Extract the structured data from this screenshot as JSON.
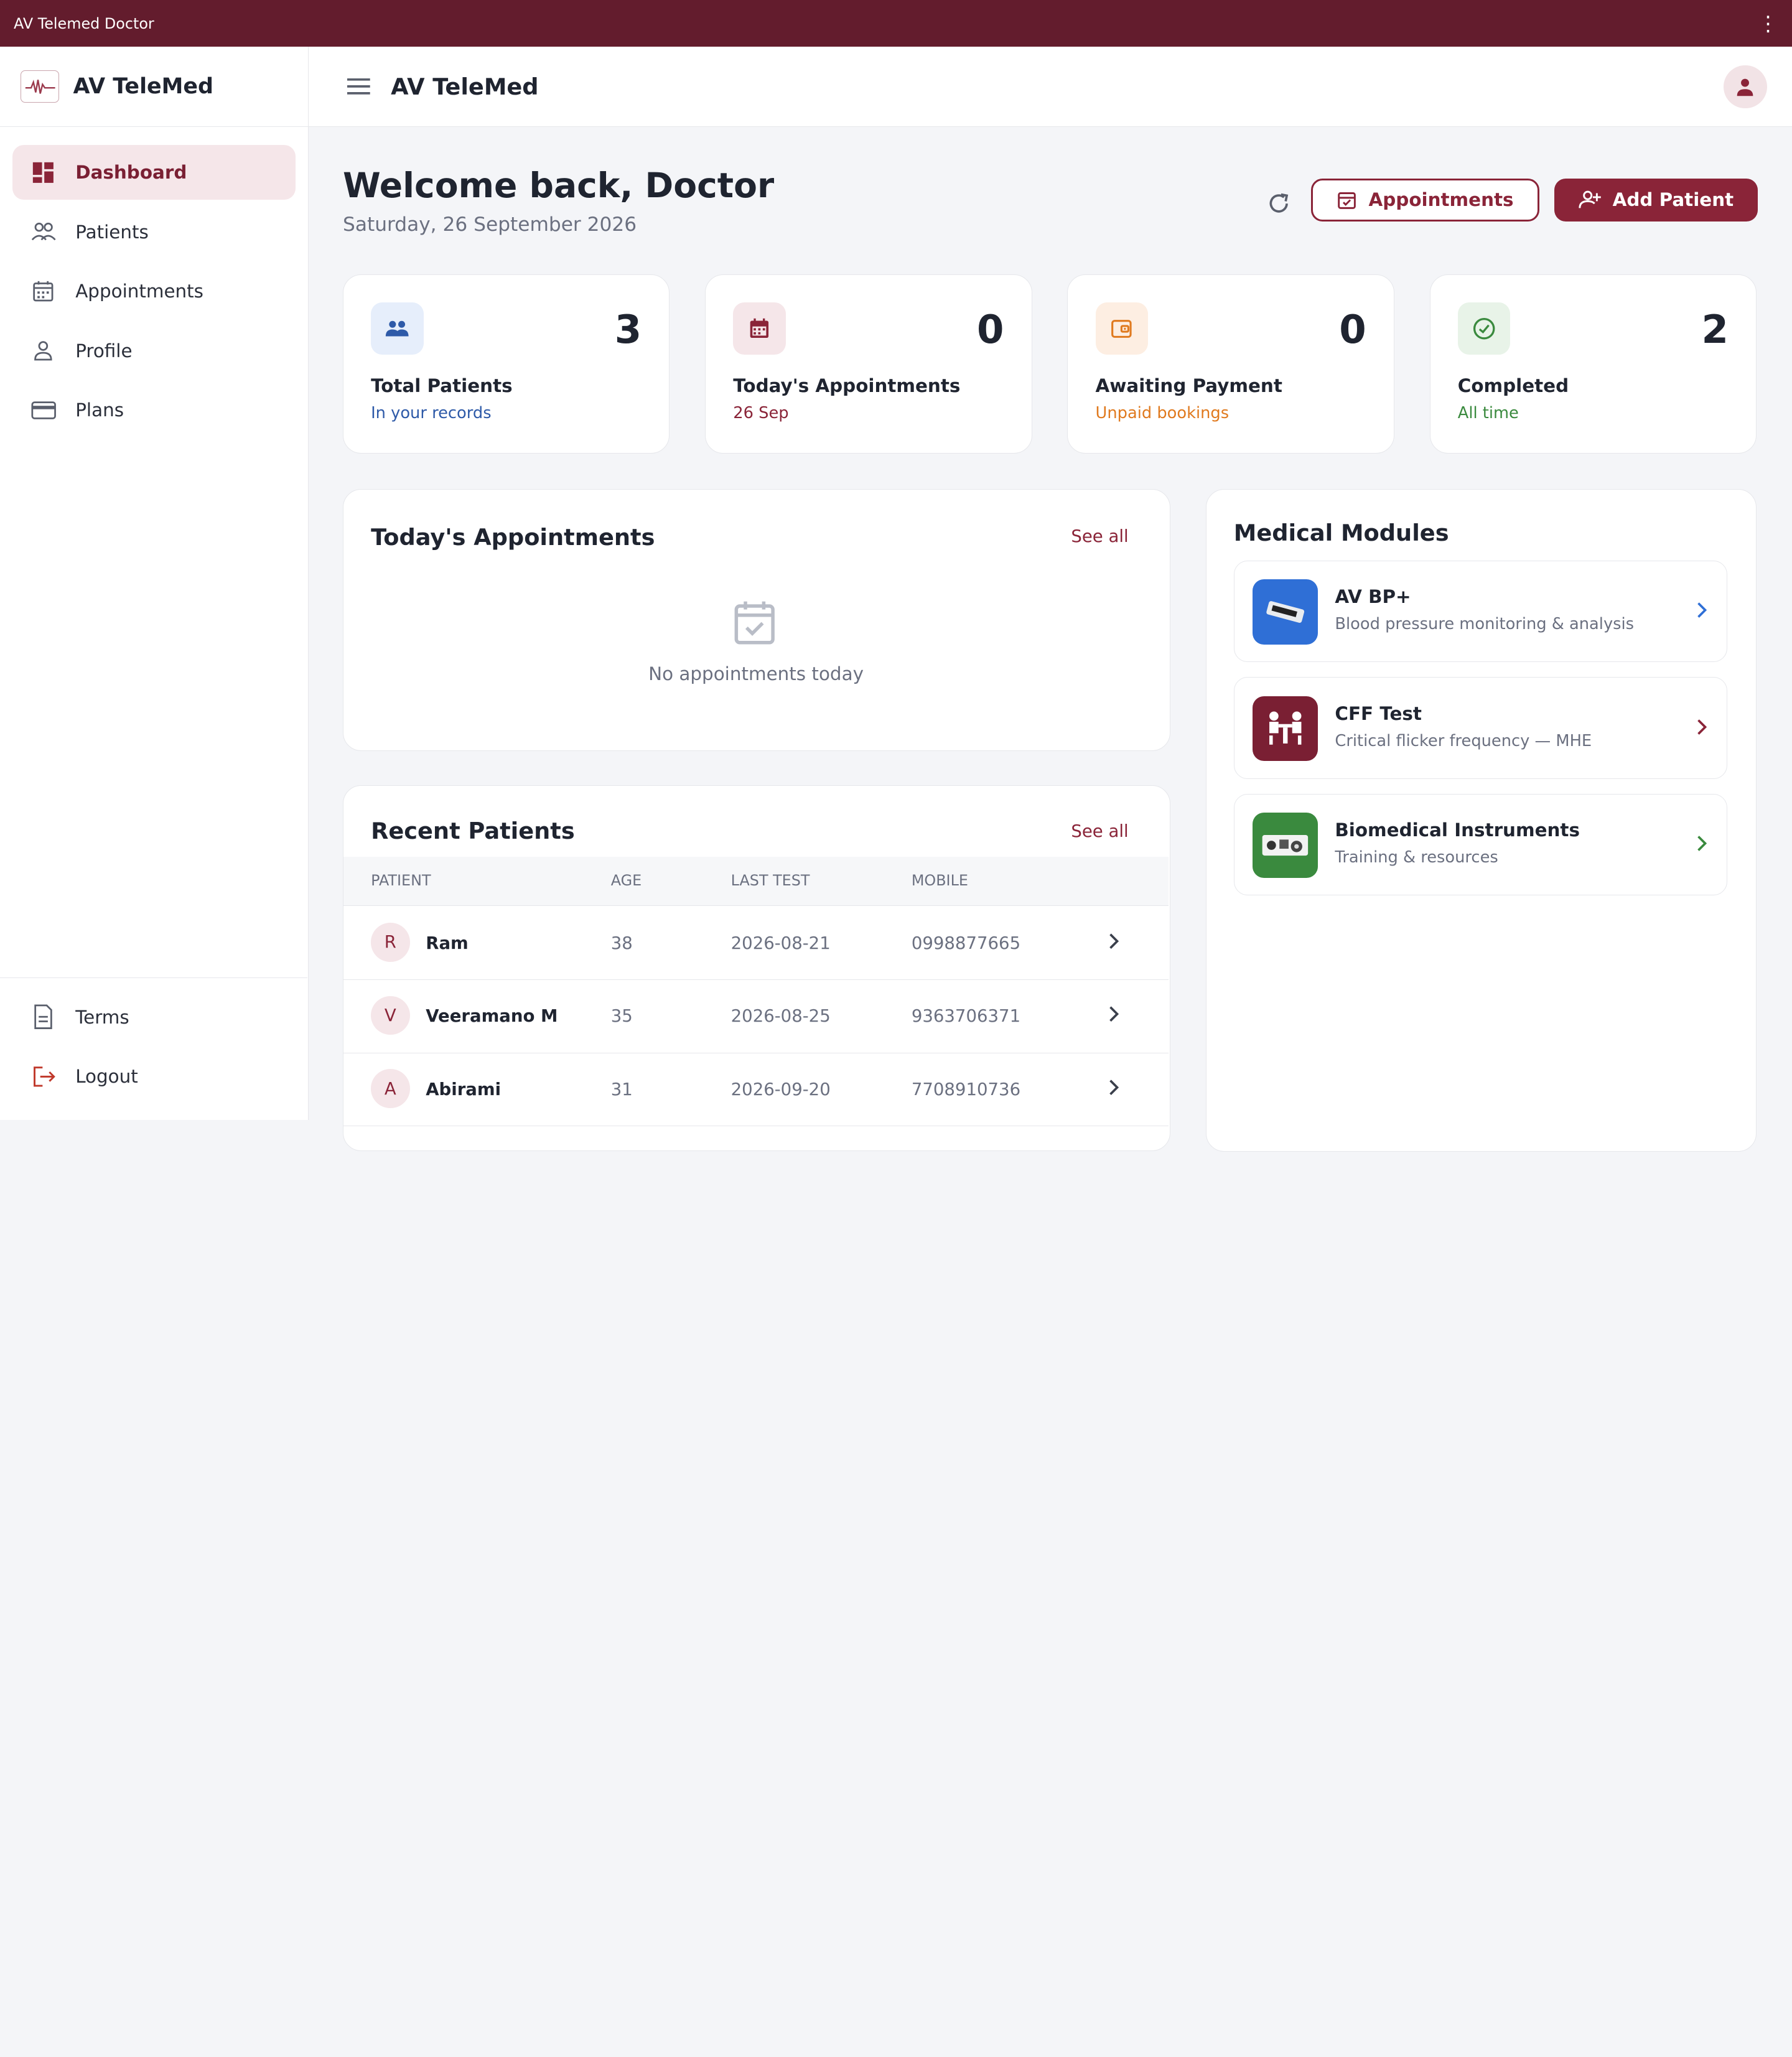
{
  "window": {
    "title": "AV Telemed Doctor"
  },
  "sidebar": {
    "brand": "AV TeleMed",
    "items": [
      {
        "label": "Dashboard",
        "icon": "dashboard-icon",
        "active": true
      },
      {
        "label": "Patients",
        "icon": "people-icon"
      },
      {
        "label": "Appointments",
        "icon": "calendar-icon"
      },
      {
        "label": "Profile",
        "icon": "person-icon"
      },
      {
        "label": "Plans",
        "icon": "credit-card-icon"
      }
    ],
    "bottom": [
      {
        "label": "Terms",
        "icon": "document-icon"
      },
      {
        "label": "Logout",
        "icon": "logout-icon"
      }
    ]
  },
  "topbar": {
    "title": "AV TeleMed"
  },
  "header": {
    "welcome": "Welcome back, Doctor",
    "date": "Saturday, 26 September 2026",
    "appointments_button": "Appointments",
    "add_patient_button": "Add Patient"
  },
  "stats": [
    {
      "value": "3",
      "label": "Total Patients",
      "sub": "In your records",
      "color": "#2e5aa8",
      "bg": "#e6eefb"
    },
    {
      "value": "0",
      "label": "Today's Appointments",
      "sub": "26 Sep",
      "color": "#8a2438",
      "bg": "#f5e6e9"
    },
    {
      "value": "0",
      "label": "Awaiting Payment",
      "sub": "Unpaid bookings",
      "color": "#e07a1f",
      "bg": "#fdeee2"
    },
    {
      "value": "2",
      "label": "Completed",
      "sub": "All time",
      "color": "#3a8a3e",
      "bg": "#e8f3e8"
    }
  ],
  "todays_appointments": {
    "title": "Today's Appointments",
    "see_all": "See all",
    "empty": "No appointments today"
  },
  "recent_patients": {
    "title": "Recent Patients",
    "see_all": "See all",
    "columns": [
      "PATIENT",
      "AGE",
      "LAST TEST",
      "MOBILE"
    ],
    "rows": [
      {
        "initial": "R",
        "name": "Ram",
        "age": "38",
        "last_test": "2026-08-21",
        "mobile": "0998877665"
      },
      {
        "initial": "V",
        "name": "Veeramano M",
        "age": "35",
        "last_test": "2026-08-25",
        "mobile": "9363706371"
      },
      {
        "initial": "A",
        "name": "Abirami",
        "age": "31",
        "last_test": "2026-09-20",
        "mobile": "7708910736"
      }
    ]
  },
  "modules": {
    "title": "Medical Modules",
    "items": [
      {
        "name": "AV BP+",
        "desc": "Blood pressure monitoring & analysis",
        "color": "#2f6fd6"
      },
      {
        "name": "CFF Test",
        "desc": "Critical flicker frequency — MHE",
        "color": "#7a1f33"
      },
      {
        "name": "Biomedical Instruments",
        "desc": "Training & resources",
        "color": "#3a8a3e"
      }
    ]
  },
  "theme": {
    "accent": "#8a2438",
    "titlebar": "#631c2d"
  }
}
